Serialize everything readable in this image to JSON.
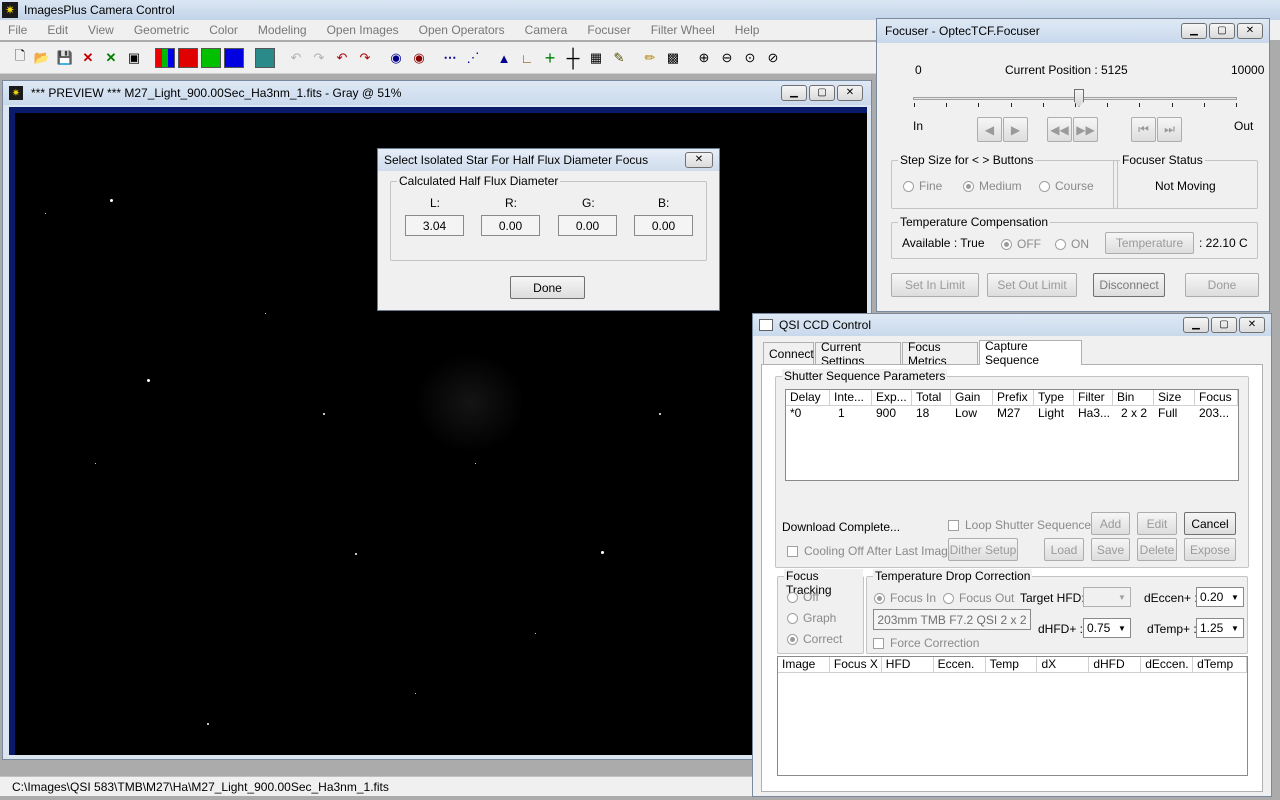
{
  "app": {
    "title": "ImagesPlus Camera Control",
    "menu": [
      "File",
      "Edit",
      "View",
      "Geometric",
      "Color",
      "Modeling",
      "Open Images",
      "Open Operators",
      "Camera",
      "Focuser",
      "Filter Wheel",
      "Help"
    ]
  },
  "preview": {
    "title": "*** PREVIEW *** M27_Light_900.00Sec_Ha3nm_1.fits - Gray @ 51%"
  },
  "status_bar": {
    "path": "C:\\Images\\QSI 583\\TMB\\M27\\Ha\\M27_Light_900.00Sec_Ha3nm_1.fits"
  },
  "hfd_dialog": {
    "title": "Select Isolated Star For Half Flux Diameter Focus",
    "group": "Calculated Half Flux Diameter",
    "labels": [
      "L:",
      "R:",
      "G:",
      "B:"
    ],
    "values": [
      "3.04",
      "0.00",
      "0.00",
      "0.00"
    ],
    "done": "Done"
  },
  "focuser": {
    "title": "Focuser - OptecTCF.Focuser",
    "min": "0",
    "max": "10000",
    "current_label": "Current Position :",
    "current_value": "5125",
    "position": 5125,
    "range_max": 10000,
    "in_label": "In",
    "out_label": "Out",
    "step_group": "Step Size for < > Buttons",
    "step_options": [
      "Fine",
      "Medium",
      "Course"
    ],
    "status_group": "Focuser Status",
    "status": "Not Moving",
    "temp_group": "Temperature Compensation",
    "available": "Available : True",
    "temp_options": [
      "OFF",
      "ON"
    ],
    "temp_button": "Temperature",
    "temp_value": ": 22.10 C",
    "buttons": [
      "Set In Limit",
      "Set Out Limit",
      "Disconnect",
      "Done"
    ]
  },
  "ccd": {
    "title": "QSI CCD Control",
    "tabs": [
      "Connect",
      "Current Settings",
      "Focus Metrics",
      "Capture Sequence"
    ],
    "shutter_group": "Shutter Sequence Parameters",
    "columns": [
      "Delay",
      "Inte...",
      "Exp...",
      "Total",
      "Gain",
      "Prefix",
      "Type",
      "Filter",
      "Bin",
      "Size",
      "Focus"
    ],
    "rows": [
      [
        "*0",
        "1",
        "900",
        "18",
        "Low",
        "M27",
        "Light",
        "Ha3...",
        "2 x 2",
        "Full",
        "203..."
      ]
    ],
    "download_status": "Download Complete...",
    "loop_shutter": "Loop Shutter Sequence",
    "cooling_off": "Cooling Off After Last Image",
    "btn_add": "Add",
    "btn_edit": "Edit",
    "btn_cancel": "Cancel",
    "btn_dither": "Dither Setup",
    "btn_load": "Load",
    "btn_save": "Save",
    "btn_delete": "Delete",
    "btn_expose": "Expose",
    "focus_tracking_group": "Focus Tracking",
    "tracking_options": [
      "Off",
      "Graph",
      "Correct"
    ],
    "temp_drop_group": "Temperature Drop Correction",
    "focus_options": [
      "Focus In",
      "Focus Out"
    ],
    "target_hfd_label": "Target HFD:",
    "target_hfd_value": "",
    "deccen_label": "dEccen+ :",
    "deccen_value": "0.20",
    "scope_value": "203mm TMB F7.2 QSI 2 x 2",
    "dhfd_label": "dHFD+ :",
    "dhfd_value": "0.75",
    "dtemp_label": "dTemp+ :",
    "dtemp_value": "1.25",
    "force_correction": "Force Correction",
    "metrics_columns": [
      "Image",
      "Focus X",
      "HFD",
      "Eccen.",
      "Temp",
      "dX",
      "dHFD",
      "dEccen.",
      "dTemp"
    ]
  }
}
